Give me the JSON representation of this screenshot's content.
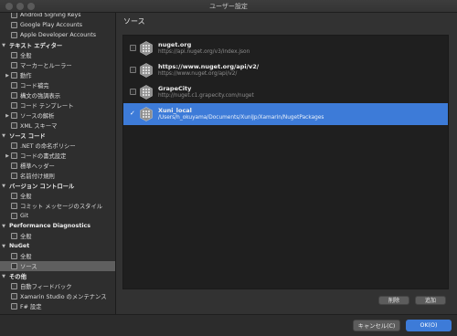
{
  "window": {
    "title": "ユーザー設定"
  },
  "sidebar": {
    "items": [
      {
        "label": "Android Signing Keys",
        "type": "item"
      },
      {
        "label": "Google Play Accounts",
        "type": "item"
      },
      {
        "label": "Apple Developer Accounts",
        "type": "item"
      },
      {
        "label": "テキスト エディター",
        "type": "header"
      },
      {
        "label": "全般",
        "type": "item"
      },
      {
        "label": "マーカーとルーラー",
        "type": "item"
      },
      {
        "label": "動作",
        "type": "item",
        "expandable": true
      },
      {
        "label": "コード補完",
        "type": "item"
      },
      {
        "label": "構文の強調表示",
        "type": "item"
      },
      {
        "label": "コード テンプレート",
        "type": "item"
      },
      {
        "label": "ソースの解析",
        "type": "item",
        "expandable": true
      },
      {
        "label": "XML スキーマ",
        "type": "item"
      },
      {
        "label": "ソース コード",
        "type": "header"
      },
      {
        "label": ".NET の命名ポリシー",
        "type": "item"
      },
      {
        "label": "コードの書式設定",
        "type": "item",
        "expandable": true
      },
      {
        "label": "標準ヘッダー",
        "type": "item"
      },
      {
        "label": "名前付け規則",
        "type": "item"
      },
      {
        "label": "バージョン コントロール",
        "type": "header"
      },
      {
        "label": "全般",
        "type": "item"
      },
      {
        "label": "コミット メッセージのスタイル",
        "type": "item"
      },
      {
        "label": "Git",
        "type": "item"
      },
      {
        "label": "Performance Diagnostics",
        "type": "header"
      },
      {
        "label": "全般",
        "type": "item"
      },
      {
        "label": "NuGet",
        "type": "header"
      },
      {
        "label": "全般",
        "type": "item"
      },
      {
        "label": "ソース",
        "type": "item",
        "selected": true
      },
      {
        "label": "その他",
        "type": "header"
      },
      {
        "label": "自動フィードバック",
        "type": "item"
      },
      {
        "label": "Xamarin Studio のメンテナンス",
        "type": "item"
      },
      {
        "label": "F# 設定",
        "type": "item"
      }
    ]
  },
  "main": {
    "title": "ソース",
    "sources": [
      {
        "name": "nuget.org",
        "url": "https://api.nuget.org/v3/index.json",
        "checked": false,
        "selected": false
      },
      {
        "name": "https://www.nuget.org/api/v2/",
        "url": "https://www.nuget.org/api/v2/",
        "checked": false,
        "selected": false
      },
      {
        "name": "GrapeCity",
        "url": "http://nuget.c1.grapecity.com/nuget",
        "checked": false,
        "selected": false
      },
      {
        "name": "Xuni_local",
        "url": "/Users/h_okuyama/Documents/XuniJp/Xamarin/NugetPackages",
        "checked": true,
        "selected": true
      }
    ],
    "remove_label": "削除",
    "add_label": "追加"
  },
  "footer": {
    "cancel_label": "キャンセル(C)",
    "ok_label": "OK(O)"
  },
  "colors": {
    "accent": "#3d7bd8",
    "selection": "#5f5f5f",
    "background": "#323232"
  }
}
